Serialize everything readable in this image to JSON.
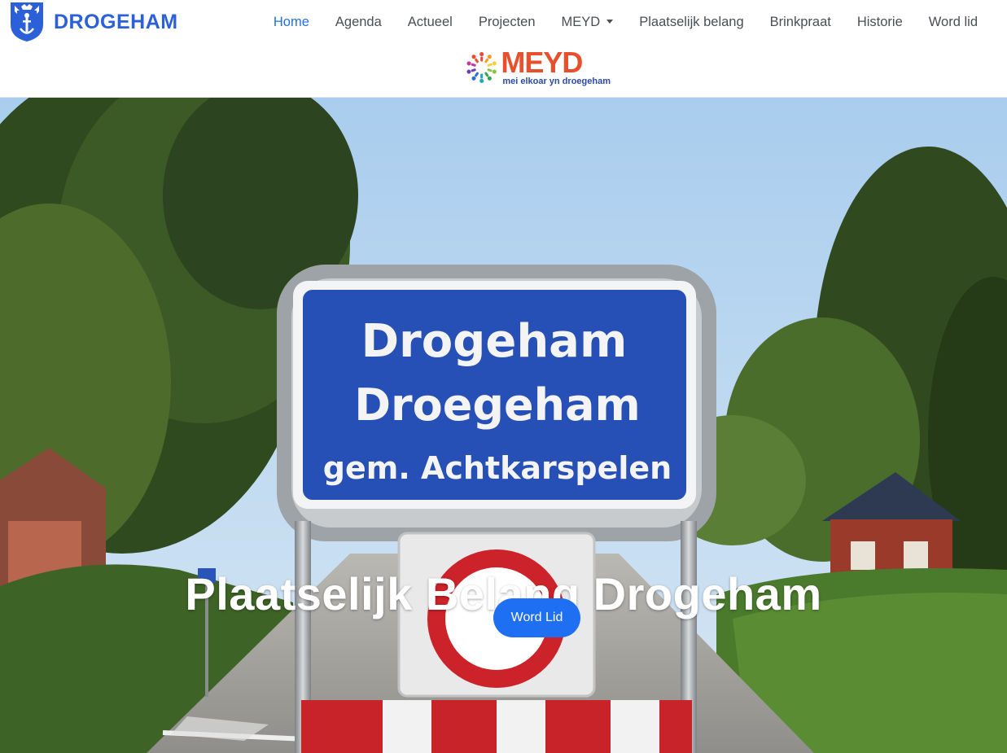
{
  "brand": {
    "name": "DROGEHAM",
    "icon": "coat-of-arms-icon",
    "color": "#2b60d9"
  },
  "nav": {
    "items": [
      {
        "label": "Home",
        "active": true
      },
      {
        "label": "Agenda"
      },
      {
        "label": "Actueel"
      },
      {
        "label": "Projecten"
      },
      {
        "label": "MEYD",
        "dropdown": true
      },
      {
        "label": "Plaatselijk belang"
      },
      {
        "label": "Brinkpraat"
      },
      {
        "label": "Historie"
      },
      {
        "label": "Word lid"
      }
    ],
    "active_color": "#2470e0"
  },
  "meyd_logo": {
    "word": "MEYD",
    "tagline": "mei elkoar yn droegeham"
  },
  "hero": {
    "sign_line1": "Drogeham",
    "sign_line2": "Droegeham",
    "sign_line3": "gem. Achtkarspelen",
    "title": "Plaatselijk Belang Drogeham",
    "button_label": "Word Lid",
    "button_color": "#1e6ff2"
  }
}
